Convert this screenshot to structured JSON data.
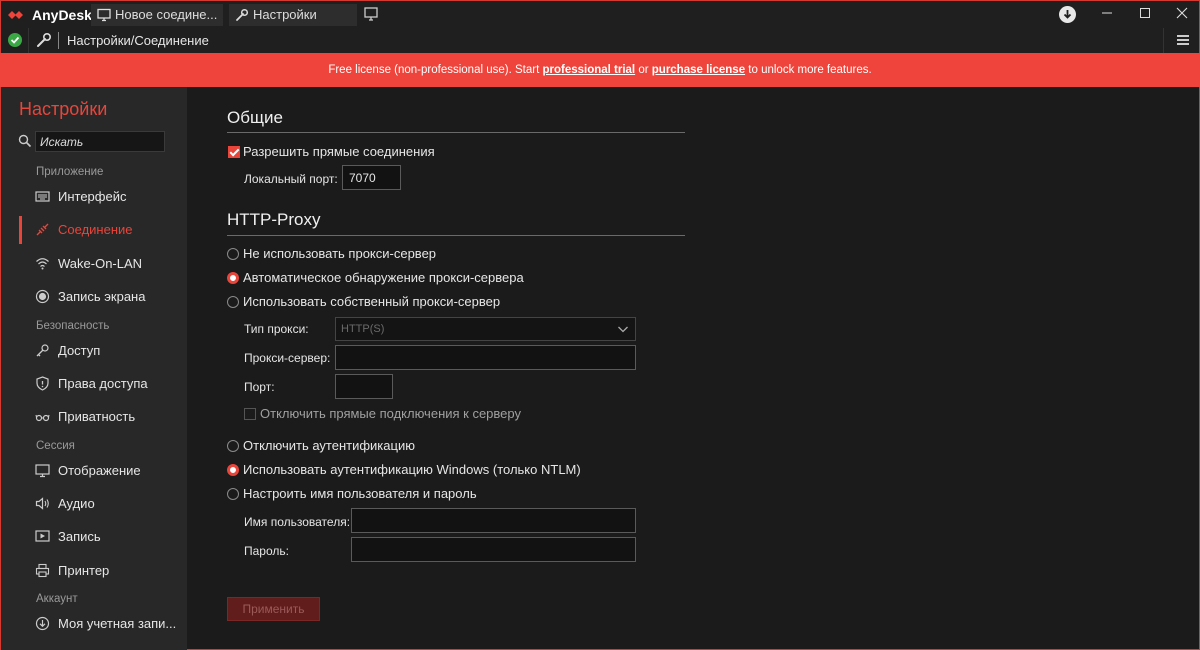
{
  "titlebar": {
    "app_name": "AnyDesk",
    "tabs": [
      {
        "label": "Новое соедине..."
      },
      {
        "label": "Настройки"
      }
    ]
  },
  "addressbar": {
    "path": "Настройки/Соединение"
  },
  "banner": {
    "text_before": "Free license (non-professional use). Start ",
    "link1": "professional trial",
    "text_mid": " or ",
    "link2": "purchase license",
    "text_after": " to unlock more features."
  },
  "sidebar": {
    "title": "Настройки",
    "search_value": "Искать",
    "sections": {
      "app": "Приложение",
      "security": "Безопасность",
      "session": "Сессия",
      "account": "Аккаунт"
    },
    "items": [
      {
        "label": "Интерфейс"
      },
      {
        "label": "Соединение"
      },
      {
        "label": "Wake-On-LAN"
      },
      {
        "label": "Запись экрана"
      },
      {
        "label": "Доступ"
      },
      {
        "label": "Права доступа"
      },
      {
        "label": "Приватность"
      },
      {
        "label": "Отображение"
      },
      {
        "label": "Аудио"
      },
      {
        "label": "Запись"
      },
      {
        "label": "Принтер"
      },
      {
        "label": "Моя учетная запи..."
      }
    ],
    "active_index": 1
  },
  "main": {
    "general": {
      "heading": "Общие",
      "allow_direct": {
        "label": "Разрешить прямые соединения",
        "checked": true
      },
      "local_port": {
        "label": "Локальный порт:",
        "value": "7070"
      }
    },
    "proxy": {
      "heading": "HTTP-Proxy",
      "options": [
        {
          "label": "Не использовать прокси-сервер",
          "selected": false
        },
        {
          "label": "Автоматическое обнаружение прокси-сервера",
          "selected": true
        },
        {
          "label": "Использовать собственный прокси-сервер",
          "selected": false
        }
      ],
      "proxy_type": {
        "label": "Тип прокси:",
        "value": "HTTP(S)"
      },
      "proxy_server": {
        "label": "Прокси-сервер:",
        "value": ""
      },
      "port": {
        "label": "Порт:",
        "value": ""
      },
      "disable_direct": {
        "label": "Отключить прямые подключения к серверу",
        "checked": false
      },
      "auth_options": [
        {
          "label": "Отключить аутентификацию",
          "selected": false
        },
        {
          "label": "Использовать аутентификацию Windows (только NTLM)",
          "selected": true
        },
        {
          "label": "Настроить имя пользователя и пароль",
          "selected": false
        }
      ],
      "username": {
        "label": "Имя пользователя:",
        "value": ""
      },
      "password": {
        "label": "Пароль:",
        "value": ""
      }
    },
    "apply_label": "Применить"
  },
  "colors": {
    "accent": "#e8453b",
    "banner": "#ef443b",
    "status_ok": "#39a845"
  }
}
